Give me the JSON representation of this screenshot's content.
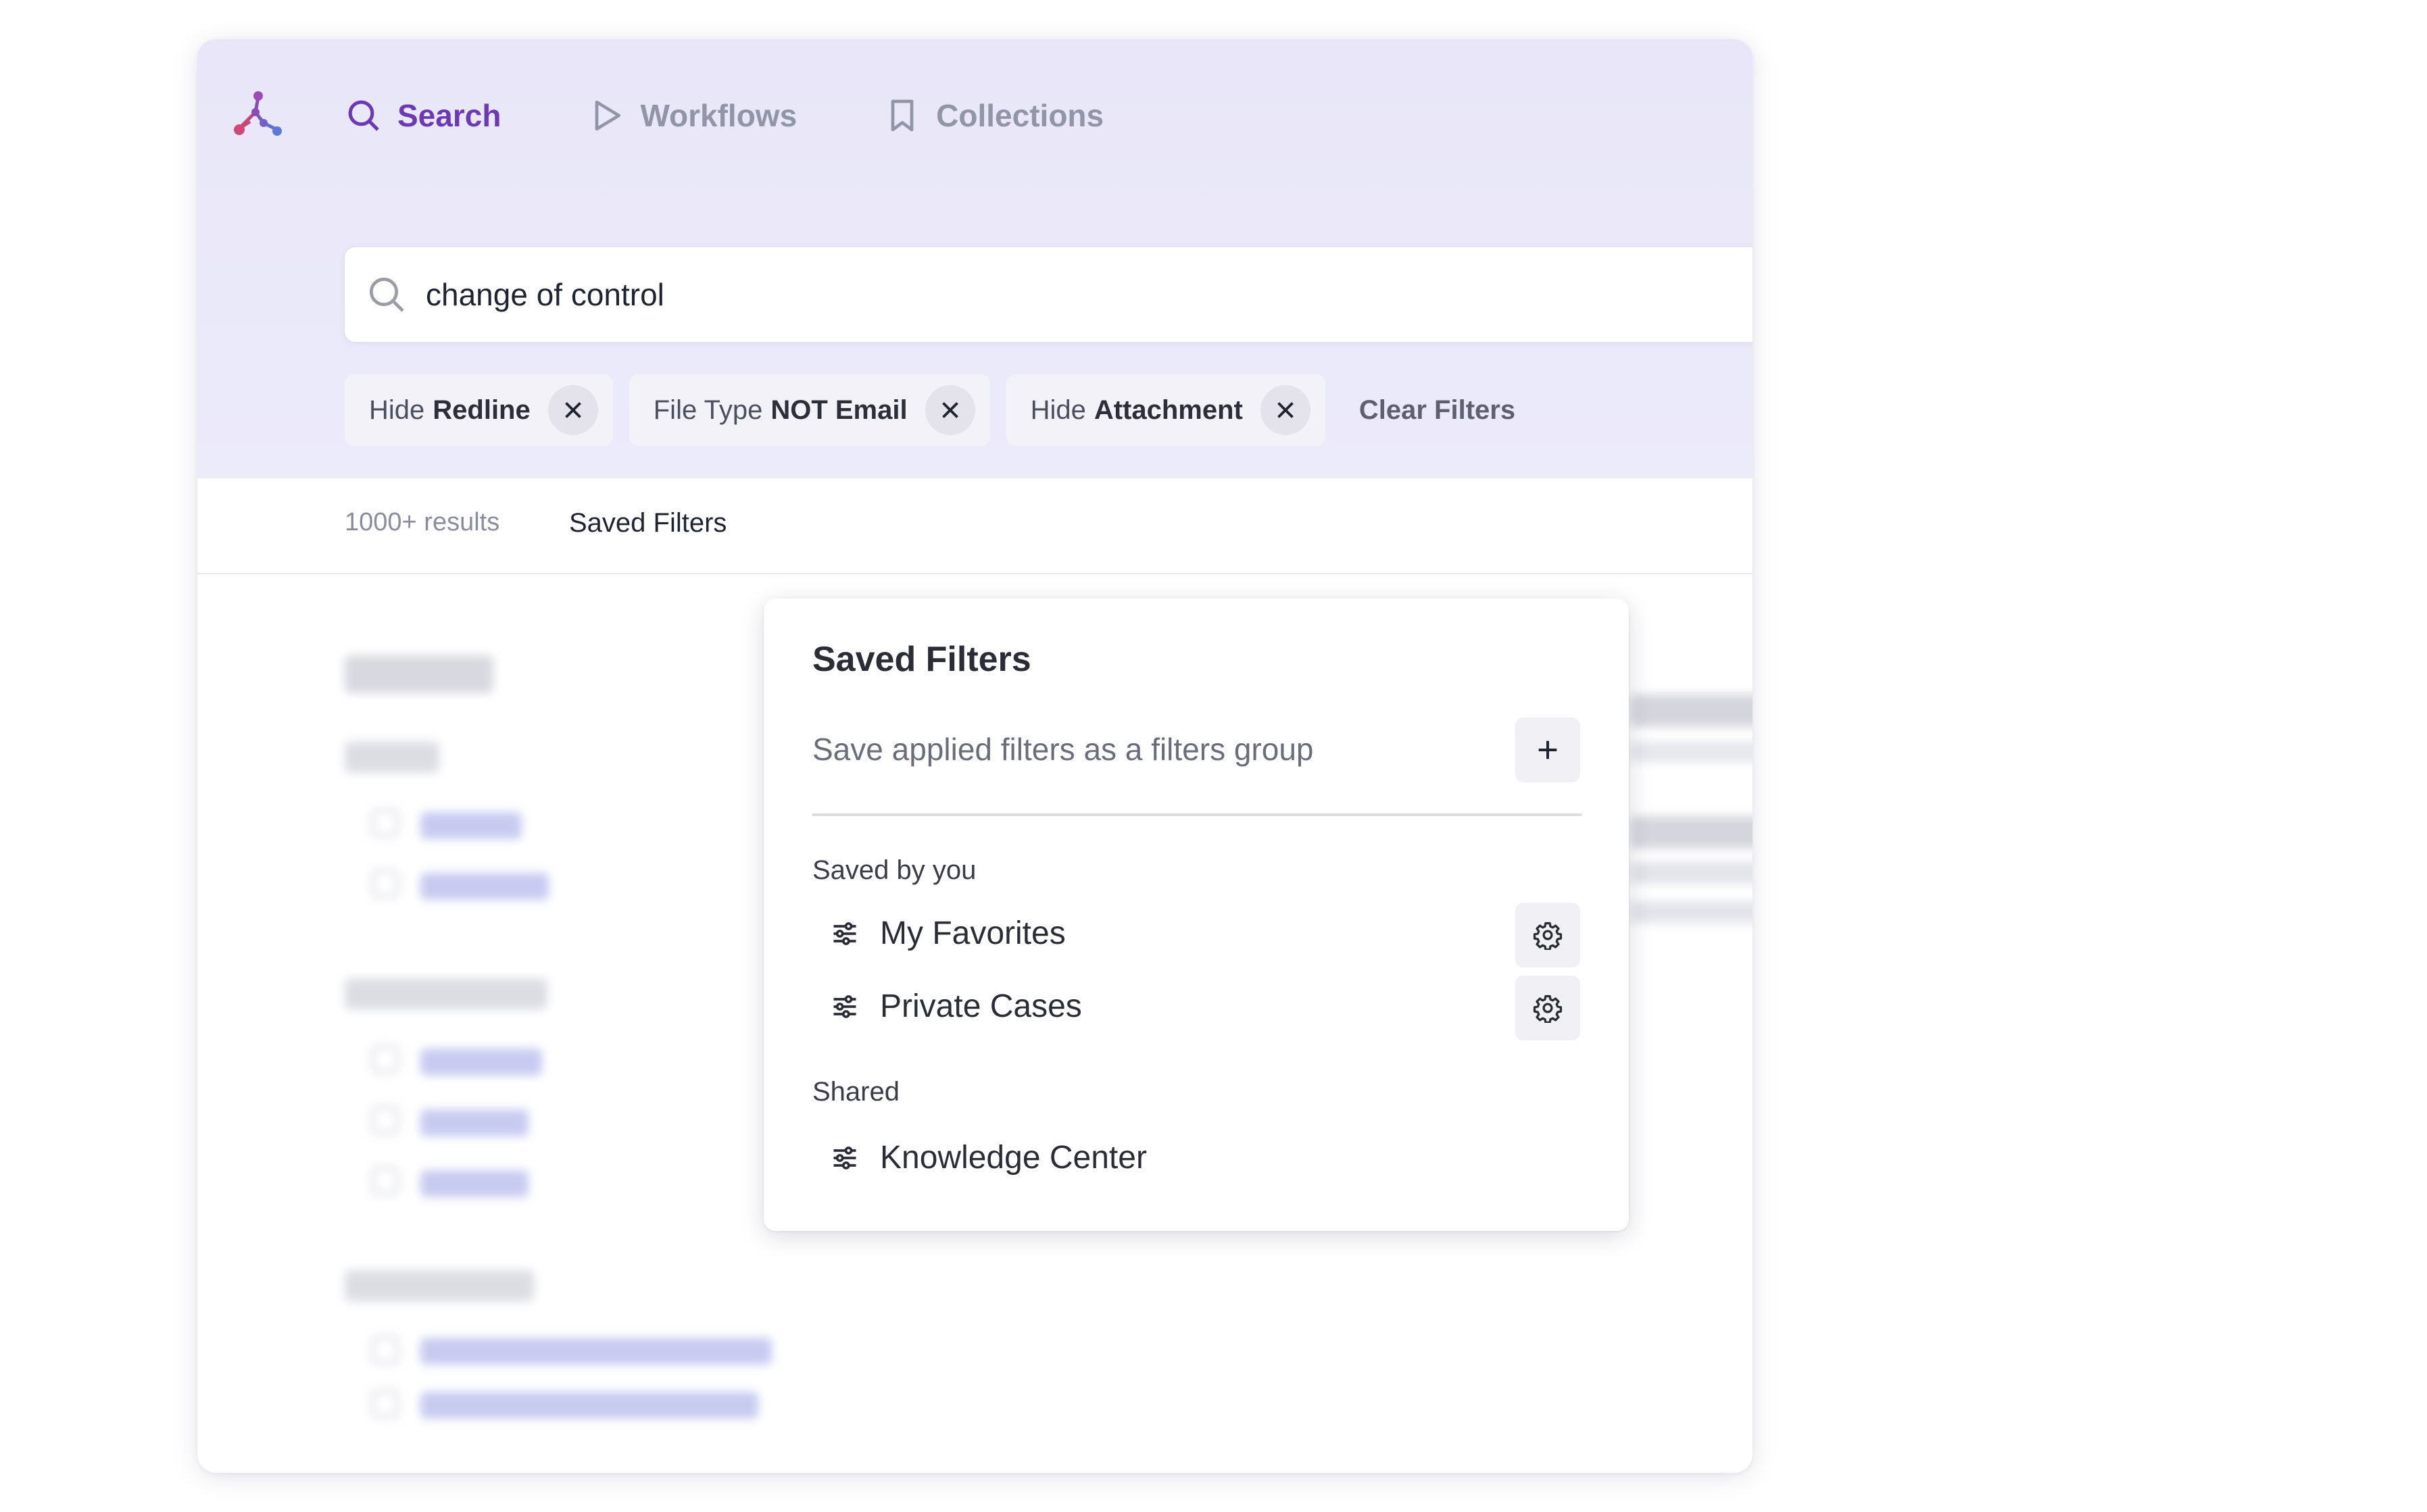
{
  "nav": {
    "items": [
      {
        "label": "Search",
        "icon": "search-icon",
        "active": true
      },
      {
        "label": "Workflows",
        "icon": "play-icon",
        "active": false
      },
      {
        "label": "Collections",
        "icon": "bookmark-icon",
        "active": false
      }
    ]
  },
  "search": {
    "value": "change of control"
  },
  "filters": {
    "chips": [
      {
        "prefix": "Hide",
        "value": "Redline"
      },
      {
        "prefix": "File Type",
        "value": "NOT Email"
      },
      {
        "prefix": "Hide",
        "value": "Attachment"
      }
    ],
    "clear_label": "Clear Filters"
  },
  "results": {
    "count": "1000+ results",
    "saved_filters_link": "Saved Filters"
  },
  "saved_filters_popover": {
    "title": "Saved Filters",
    "save_prompt": "Save applied filters as a filters group",
    "saved_by_you_label": "Saved by you",
    "saved_by_you": [
      {
        "label": "My Favorites"
      },
      {
        "label": "Private Cases"
      }
    ],
    "shared_label": "Shared",
    "shared": [
      {
        "label": "Knowledge Center"
      }
    ]
  },
  "colors": {
    "accent": "#6b39b5",
    "hero_bg": "#e9e7f8",
    "link": "#4b57c8"
  }
}
